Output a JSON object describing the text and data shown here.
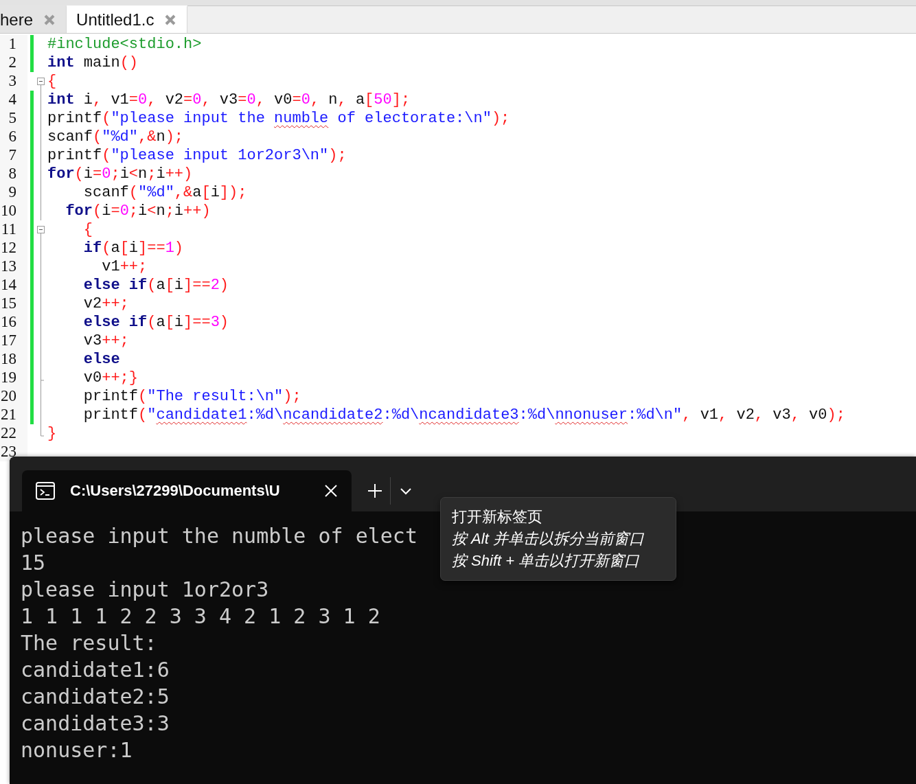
{
  "editor": {
    "tabs": [
      {
        "label": "here",
        "selected": false
      },
      {
        "label": "Untitled1.c",
        "selected": true
      }
    ],
    "lines": [
      {
        "number": "1",
        "changed": true,
        "tokens": [
          {
            "kind": "pp",
            "text": "#include<stdio.h>"
          }
        ]
      },
      {
        "number": "2",
        "changed": true,
        "tokens": [
          {
            "kind": "k",
            "text": "int"
          },
          {
            "kind": "p",
            "text": " main"
          },
          {
            "kind": "o",
            "text": "()"
          }
        ]
      },
      {
        "number": "3",
        "changed": false,
        "fold_marker": {
          "kind": "start"
        },
        "tokens": [
          {
            "kind": "o",
            "text": "{"
          }
        ]
      },
      {
        "number": "4",
        "changed": true,
        "fold_marker": {
          "kind": "mid"
        },
        "tokens": [
          {
            "kind": "k",
            "text": "int"
          },
          {
            "kind": "p",
            "text": " i"
          },
          {
            "kind": "o",
            "text": ", "
          },
          {
            "kind": "p",
            "text": "v1"
          },
          {
            "kind": "o",
            "text": "="
          },
          {
            "kind": "n",
            "text": "0"
          },
          {
            "kind": "o",
            "text": ", "
          },
          {
            "kind": "p",
            "text": "v2"
          },
          {
            "kind": "o",
            "text": "="
          },
          {
            "kind": "n",
            "text": "0"
          },
          {
            "kind": "o",
            "text": ", "
          },
          {
            "kind": "p",
            "text": "v3"
          },
          {
            "kind": "o",
            "text": "="
          },
          {
            "kind": "n",
            "text": "0"
          },
          {
            "kind": "o",
            "text": ", "
          },
          {
            "kind": "p",
            "text": "v0"
          },
          {
            "kind": "o",
            "text": "="
          },
          {
            "kind": "n",
            "text": "0"
          },
          {
            "kind": "o",
            "text": ", "
          },
          {
            "kind": "p",
            "text": "n"
          },
          {
            "kind": "o",
            "text": ", "
          },
          {
            "kind": "p",
            "text": "a"
          },
          {
            "kind": "o",
            "text": "["
          },
          {
            "kind": "n",
            "text": "50"
          },
          {
            "kind": "o",
            "text": "];"
          }
        ]
      },
      {
        "number": "5",
        "changed": true,
        "fold_marker": {
          "kind": "mid"
        },
        "tokens": [
          {
            "kind": "p",
            "text": "printf"
          },
          {
            "kind": "o",
            "text": "("
          },
          {
            "kind": "s",
            "text": "\"please input the "
          },
          {
            "kind": "s",
            "text": "numble",
            "squiggle": true
          },
          {
            "kind": "s",
            "text": " of electorate:\\n\""
          },
          {
            "kind": "o",
            "text": ");"
          }
        ]
      },
      {
        "number": "6",
        "changed": true,
        "fold_marker": {
          "kind": "mid"
        },
        "tokens": [
          {
            "kind": "p",
            "text": "scanf"
          },
          {
            "kind": "o",
            "text": "("
          },
          {
            "kind": "s",
            "text": "\"%d\""
          },
          {
            "kind": "o",
            "text": ",&"
          },
          {
            "kind": "p",
            "text": "n"
          },
          {
            "kind": "o",
            "text": ");"
          }
        ]
      },
      {
        "number": "7",
        "changed": true,
        "fold_marker": {
          "kind": "mid"
        },
        "tokens": [
          {
            "kind": "p",
            "text": "printf"
          },
          {
            "kind": "o",
            "text": "("
          },
          {
            "kind": "s",
            "text": "\"please input 1or2or3\\n\""
          },
          {
            "kind": "o",
            "text": ");"
          }
        ]
      },
      {
        "number": "8",
        "changed": true,
        "fold_marker": {
          "kind": "mid"
        },
        "tokens": [
          {
            "kind": "k",
            "text": "for"
          },
          {
            "kind": "o",
            "text": "("
          },
          {
            "kind": "p",
            "text": "i"
          },
          {
            "kind": "o",
            "text": "="
          },
          {
            "kind": "n",
            "text": "0"
          },
          {
            "kind": "o",
            "text": ";"
          },
          {
            "kind": "p",
            "text": "i"
          },
          {
            "kind": "o",
            "text": "<"
          },
          {
            "kind": "p",
            "text": "n"
          },
          {
            "kind": "o",
            "text": ";"
          },
          {
            "kind": "p",
            "text": "i"
          },
          {
            "kind": "o",
            "text": "++)"
          }
        ]
      },
      {
        "number": "9",
        "changed": true,
        "fold_marker": {
          "kind": "mid"
        },
        "tokens": [
          {
            "kind": "p",
            "text": "    scanf"
          },
          {
            "kind": "o",
            "text": "("
          },
          {
            "kind": "s",
            "text": "\"%d\""
          },
          {
            "kind": "o",
            "text": ",&"
          },
          {
            "kind": "p",
            "text": "a"
          },
          {
            "kind": "o",
            "text": "["
          },
          {
            "kind": "p",
            "text": "i"
          },
          {
            "kind": "o",
            "text": "]);"
          }
        ]
      },
      {
        "number": "10",
        "changed": true,
        "fold_marker": {
          "kind": "mid"
        },
        "tokens": [
          {
            "kind": "k",
            "text": "  for"
          },
          {
            "kind": "o",
            "text": "("
          },
          {
            "kind": "p",
            "text": "i"
          },
          {
            "kind": "o",
            "text": "="
          },
          {
            "kind": "n",
            "text": "0"
          },
          {
            "kind": "o",
            "text": ";"
          },
          {
            "kind": "p",
            "text": "i"
          },
          {
            "kind": "o",
            "text": "<"
          },
          {
            "kind": "p",
            "text": "n"
          },
          {
            "kind": "o",
            "text": ";"
          },
          {
            "kind": "p",
            "text": "i"
          },
          {
            "kind": "o",
            "text": "++)"
          }
        ]
      },
      {
        "number": "11",
        "changed": true,
        "fold_marker": {
          "kind": "start"
        },
        "tokens": [
          {
            "kind": "o",
            "text": "    {"
          }
        ]
      },
      {
        "number": "12",
        "changed": true,
        "fold_marker": {
          "kind": "mid"
        },
        "tokens": [
          {
            "kind": "k",
            "text": "    if"
          },
          {
            "kind": "o",
            "text": "("
          },
          {
            "kind": "p",
            "text": "a"
          },
          {
            "kind": "o",
            "text": "["
          },
          {
            "kind": "p",
            "text": "i"
          },
          {
            "kind": "o",
            "text": "]=="
          },
          {
            "kind": "n",
            "text": "1"
          },
          {
            "kind": "o",
            "text": ")"
          }
        ]
      },
      {
        "number": "13",
        "changed": true,
        "fold_marker": {
          "kind": "mid"
        },
        "tokens": [
          {
            "kind": "p",
            "text": "      v1"
          },
          {
            "kind": "o",
            "text": "++;"
          }
        ]
      },
      {
        "number": "14",
        "changed": true,
        "fold_marker": {
          "kind": "mid"
        },
        "tokens": [
          {
            "kind": "k",
            "text": "    else if"
          },
          {
            "kind": "o",
            "text": "("
          },
          {
            "kind": "p",
            "text": "a"
          },
          {
            "kind": "o",
            "text": "["
          },
          {
            "kind": "p",
            "text": "i"
          },
          {
            "kind": "o",
            "text": "]=="
          },
          {
            "kind": "n",
            "text": "2"
          },
          {
            "kind": "o",
            "text": ")"
          }
        ]
      },
      {
        "number": "15",
        "changed": true,
        "fold_marker": {
          "kind": "mid"
        },
        "tokens": [
          {
            "kind": "p",
            "text": "    v2"
          },
          {
            "kind": "o",
            "text": "++;"
          }
        ]
      },
      {
        "number": "16",
        "changed": true,
        "fold_marker": {
          "kind": "mid"
        },
        "tokens": [
          {
            "kind": "k",
            "text": "    else if"
          },
          {
            "kind": "o",
            "text": "("
          },
          {
            "kind": "p",
            "text": "a"
          },
          {
            "kind": "o",
            "text": "["
          },
          {
            "kind": "p",
            "text": "i"
          },
          {
            "kind": "o",
            "text": "]=="
          },
          {
            "kind": "n",
            "text": "3"
          },
          {
            "kind": "o",
            "text": ")"
          }
        ]
      },
      {
        "number": "17",
        "changed": true,
        "fold_marker": {
          "kind": "mid"
        },
        "tokens": [
          {
            "kind": "p",
            "text": "    v3"
          },
          {
            "kind": "o",
            "text": "++;"
          }
        ]
      },
      {
        "number": "18",
        "changed": true,
        "fold_marker": {
          "kind": "mid"
        },
        "tokens": [
          {
            "kind": "k",
            "text": "    else"
          }
        ]
      },
      {
        "number": "19",
        "changed": true,
        "fold_marker": {
          "kind": "end"
        },
        "tokens": [
          {
            "kind": "p",
            "text": "    v0"
          },
          {
            "kind": "o",
            "text": "++;}"
          }
        ]
      },
      {
        "number": "20",
        "changed": true,
        "fold_marker": {
          "kind": "mid"
        },
        "tokens": [
          {
            "kind": "p",
            "text": "    printf"
          },
          {
            "kind": "o",
            "text": "("
          },
          {
            "kind": "s",
            "text": "\"The result:\\n\""
          },
          {
            "kind": "o",
            "text": ");"
          }
        ]
      },
      {
        "number": "21",
        "changed": true,
        "fold_marker": {
          "kind": "mid"
        },
        "tokens": [
          {
            "kind": "p",
            "text": "    printf"
          },
          {
            "kind": "o",
            "text": "("
          },
          {
            "kind": "s",
            "text": "\""
          },
          {
            "kind": "s",
            "text": "candidate1",
            "squiggle": true
          },
          {
            "kind": "s",
            "text": ":%d\\"
          },
          {
            "kind": "s",
            "text": "ncandidate2",
            "squiggle": true
          },
          {
            "kind": "s",
            "text": ":%d\\"
          },
          {
            "kind": "s",
            "text": "ncandidate3",
            "squiggle": true
          },
          {
            "kind": "s",
            "text": ":%d\\"
          },
          {
            "kind": "s",
            "text": "nnonuser",
            "squiggle": true
          },
          {
            "kind": "s",
            "text": ":%d\\n\""
          },
          {
            "kind": "o",
            "text": ", "
          },
          {
            "kind": "p",
            "text": "v1"
          },
          {
            "kind": "o",
            "text": ", "
          },
          {
            "kind": "p",
            "text": "v2"
          },
          {
            "kind": "o",
            "text": ", "
          },
          {
            "kind": "p",
            "text": "v3"
          },
          {
            "kind": "o",
            "text": ", "
          },
          {
            "kind": "p",
            "text": "v0"
          },
          {
            "kind": "o",
            "text": ");"
          }
        ]
      },
      {
        "number": "22",
        "changed": false,
        "fold_marker": {
          "kind": "last"
        },
        "tokens": [
          {
            "kind": "o",
            "text": "}"
          }
        ]
      },
      {
        "number": "23",
        "changed": false
      }
    ]
  },
  "terminal": {
    "tab_title": "C:\\Users\\27299\\Documents\\U",
    "output": [
      "please input the numble of elect",
      "15",
      "please input 1or2or3",
      "1 1 1 1 2 2 3 3 4 2 1 2 3 1 2",
      "The result:",
      "candidate1:6",
      "candidate2:5",
      "candidate3:3",
      "nonuser:1"
    ],
    "tooltip": [
      {
        "kind": "title",
        "text": "打开新标签页"
      },
      {
        "kind": "hint",
        "text": "按 Alt 并单击以拆分当前窗口"
      },
      {
        "kind": "hint",
        "text": "按 Shift + 单击以打开新窗口"
      }
    ]
  }
}
